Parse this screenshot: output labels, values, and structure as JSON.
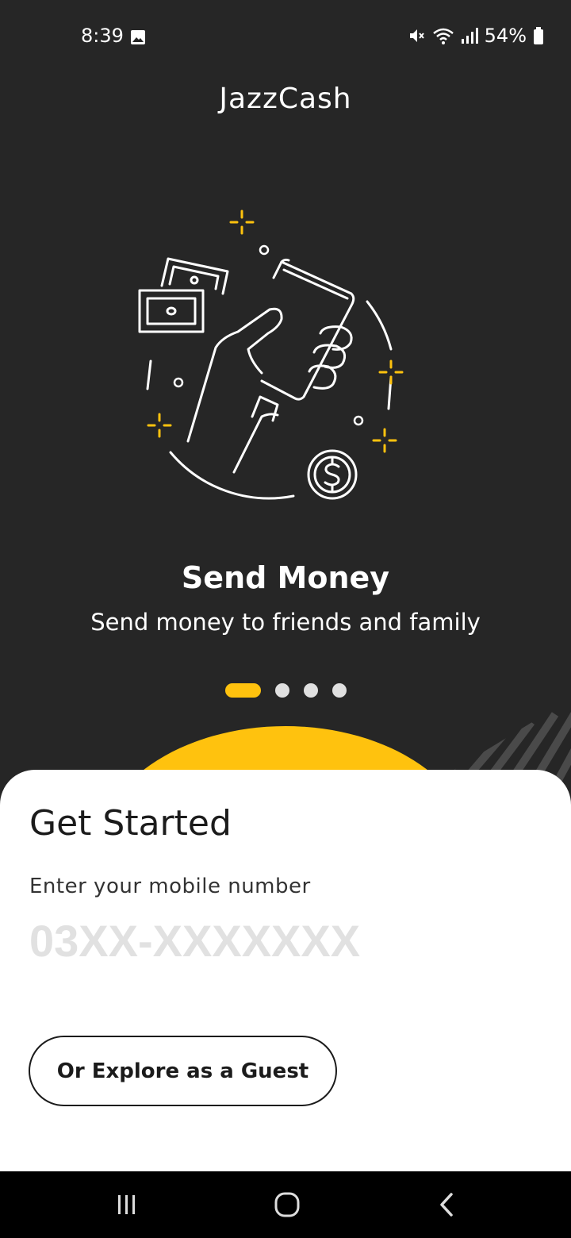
{
  "status_bar": {
    "time": "8:39",
    "battery": "54%",
    "icons": [
      "image-icon",
      "mute-icon",
      "wifi-icon",
      "signal-icon",
      "battery-icon"
    ]
  },
  "app": {
    "title": "JazzCash"
  },
  "onboarding": {
    "illustration": "send-money-illustration",
    "slide_title": "Send Money",
    "slide_subtitle": "Send money to friends and family",
    "slides_total": 4,
    "active_slide_index": 0
  },
  "login": {
    "heading": "Get Started",
    "mobile_label": "Enter your mobile number",
    "mobile_placeholder": "03XX-XXXXXXX",
    "mobile_value": "",
    "guest_button_label": "Or Explore as a Guest"
  },
  "nav_bar": {
    "buttons": [
      "recent-apps-icon",
      "home-icon",
      "back-icon"
    ]
  },
  "colors": {
    "background_dark": "#262626",
    "accent_yellow": "#FFC20E",
    "card_white": "#FFFFFF",
    "text_dark": "#1B1B1B",
    "placeholder_gray": "#E1E1E1"
  }
}
